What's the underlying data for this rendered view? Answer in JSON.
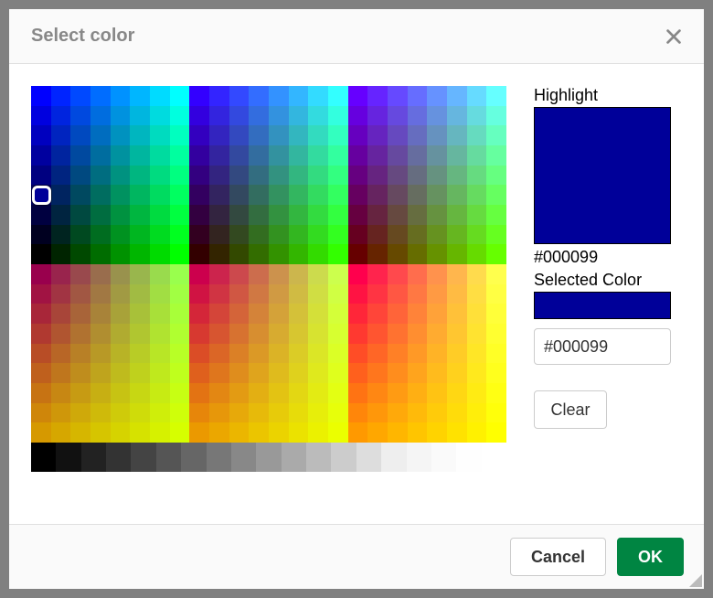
{
  "dialog": {
    "title": "Select color",
    "close_icon": "close-icon"
  },
  "highlight": {
    "label": "Highlight",
    "color": "#000099",
    "hex_readout": "#000099"
  },
  "selected": {
    "label": "Selected Color",
    "color": "#000099"
  },
  "hex_input": {
    "value": "#000099"
  },
  "buttons": {
    "clear": "Clear",
    "cancel": "Cancel",
    "ok": "OK"
  },
  "palette": {
    "selector": {
      "row": 5,
      "col": 0,
      "color": "#000099"
    },
    "block_size": {
      "cols": 8,
      "rows": 6
    },
    "blocks": [
      {
        "base_red": 0,
        "sign": 1
      },
      {
        "base_red": 51,
        "sign": 1
      },
      {
        "base_red": 102,
        "sign": 1
      },
      {
        "base_red": 153,
        "sign": -1
      },
      {
        "base_red": 204,
        "sign": -1
      },
      {
        "base_red": 255,
        "sign": -1
      }
    ],
    "axis_levels": [
      0,
      51,
      102,
      153,
      204,
      255
    ],
    "greys": [
      "#000000",
      "#111111",
      "#222222",
      "#333333",
      "#444444",
      "#555555",
      "#666666",
      "#777777",
      "#888888",
      "#999999",
      "#aaaaaa",
      "#bbbbbb",
      "#cccccc",
      "#dddddd",
      "#eeeeee",
      "#f5f5f5",
      "#fafafa",
      "#fefefe",
      "#ffffff"
    ]
  }
}
